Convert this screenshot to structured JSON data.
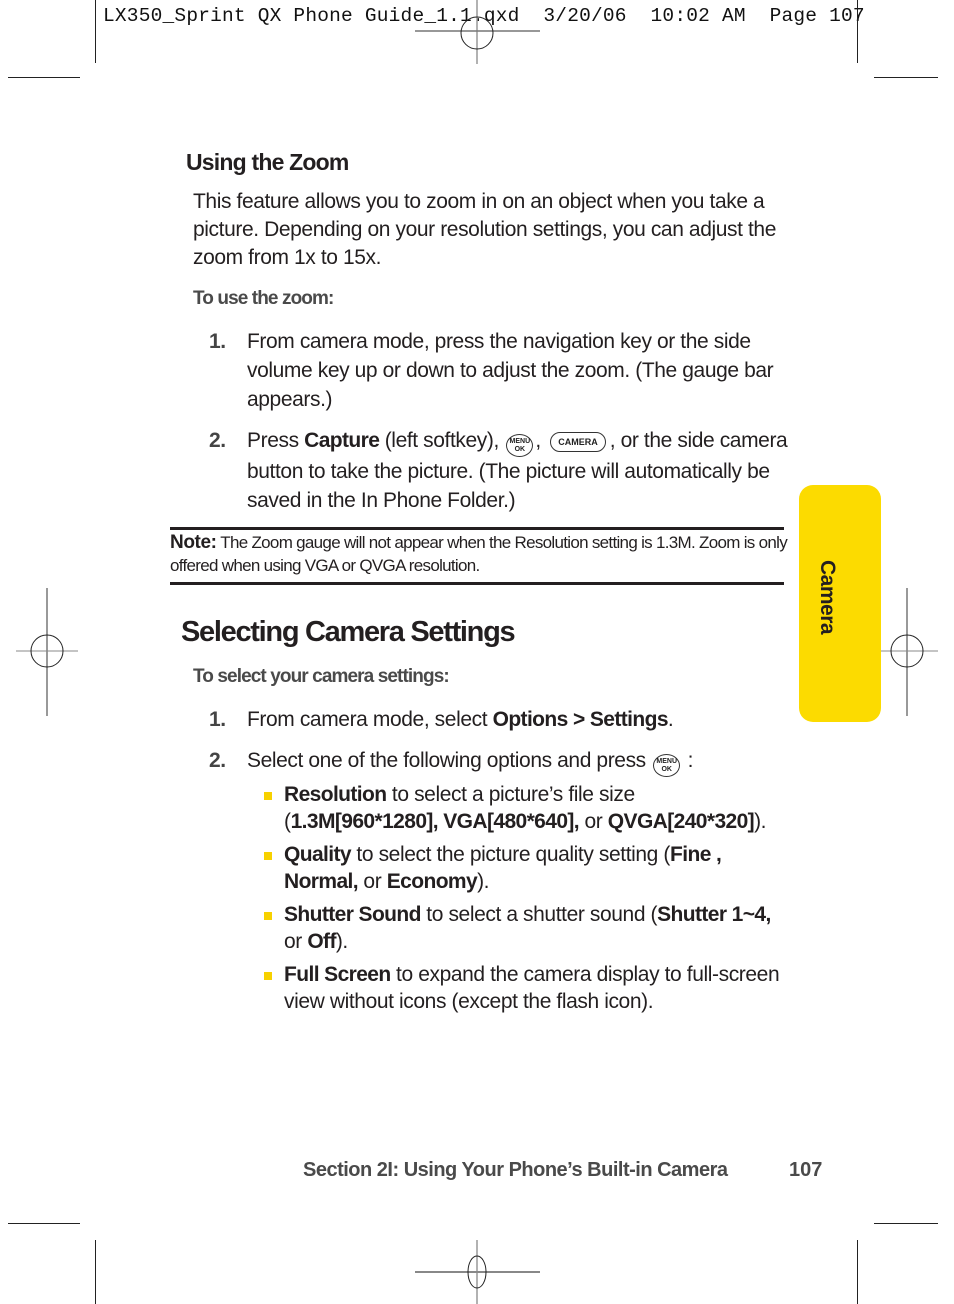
{
  "slug": {
    "filename": "LX350_Sprint QX Phone Guide_1.1.qxd",
    "date": "3/20/06",
    "time": "10:02 AM",
    "page_label": "Page 107"
  },
  "zoom_section": {
    "heading": "Using the Zoom",
    "body": "This feature allows you to zoom in on an object when you take a picture. Depending on your resolution settings, you can adjust the zoom from 1x to 15x.",
    "lead": "To use the zoom:",
    "steps": [
      {
        "num": "1.",
        "text": "From camera mode, press the navigation key or the side volume key up or down to adjust the zoom. (The gauge bar appears.)"
      },
      {
        "num": "2.",
        "prefix": "Press ",
        "bold": "Capture",
        "after_bold": " (left softkey), ",
        "sep": ", ",
        "suffix": ", or the side camera button to take the picture. (The picture will automatically be saved in the In Phone Folder.)"
      }
    ]
  },
  "keys": {
    "menu_top": "MENU",
    "menu_bottom": "OK",
    "camera": "CAMERA"
  },
  "note": {
    "label": "Note:",
    "text": " The Zoom gauge will not appear when the Resolution setting is 1.3M. Zoom is only offered when using VGA or QVGA resolution."
  },
  "settings_section": {
    "heading": "Selecting Camera Settings",
    "lead": "To select your camera settings:",
    "steps": [
      {
        "num": "1.",
        "prefix": "From camera mode, select ",
        "bold": "Options > Settings",
        "suffix": "."
      },
      {
        "num": "2.",
        "prefix": "Select one of the following options and press ",
        "suffix": " :"
      }
    ],
    "bullets": [
      {
        "term": "Resolution",
        "text": " to select a picture’s file size (",
        "opt1": "1.3M[960*1280], VGA[480*640],",
        "mid": " or ",
        "opt2": "QVGA[240*320]",
        "end": ")."
      },
      {
        "term": "Quality",
        "text": " to select the picture quality setting (",
        "opt1": "Fine , Normal,",
        "mid": " or ",
        "opt2": "Economy",
        "end": ")."
      },
      {
        "term": "Shutter Sound",
        "text": " to select a shutter sound (",
        "opt1": "Shutter 1~4,",
        "mid": " or ",
        "opt2": "Off",
        "end": ")."
      },
      {
        "term": "Full Screen",
        "text": " to expand the camera display to full-screen view without icons (except the flash icon)."
      }
    ]
  },
  "side_tab": {
    "label": "Camera",
    "color": "#fcdb00"
  },
  "footer": {
    "section": "Section 2I: Using Your Phone’s Built-in Camera",
    "page": "107"
  },
  "colors": {
    "accent_yellow": "#fcdb00",
    "bullet_yellow": "#f7d100",
    "text": "#231f20",
    "muted_heading": "#4a4a4a"
  }
}
